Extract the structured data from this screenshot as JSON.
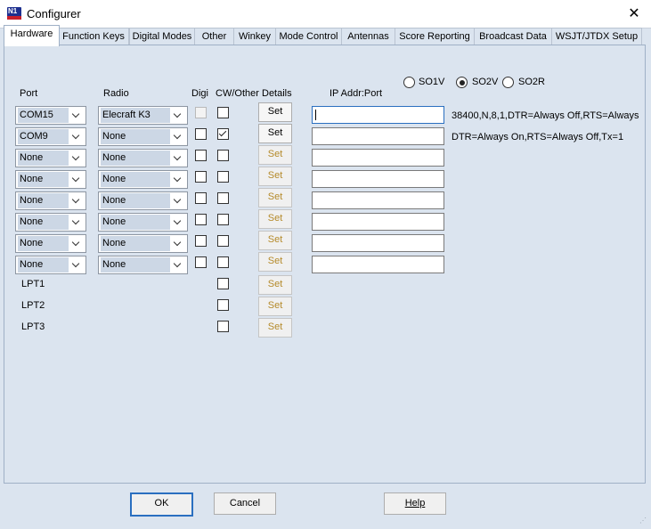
{
  "window": {
    "title": "Configurer",
    "close_glyph": "✕"
  },
  "tabs": [
    {
      "label": "Hardware",
      "active": true
    },
    {
      "label": "Function Keys"
    },
    {
      "label": "Digital Modes"
    },
    {
      "label": "Other"
    },
    {
      "label": "Winkey"
    },
    {
      "label": "Mode Control"
    },
    {
      "label": "Antennas"
    },
    {
      "label": "Score Reporting"
    },
    {
      "label": "Broadcast Data"
    },
    {
      "label": "WSJT/JTDX Setup"
    }
  ],
  "mode_radios": [
    {
      "label": "SO1V",
      "selected": false
    },
    {
      "label": "SO2V",
      "selected": true
    },
    {
      "label": "SO2R",
      "selected": false
    }
  ],
  "headers": {
    "port": "Port",
    "radio": "Radio",
    "digi": "Digi",
    "cw_other": "CW/Other",
    "details": "Details",
    "ip": "IP Addr:Port"
  },
  "rows": [
    {
      "port": "COM15",
      "radio": "Elecraft K3",
      "digi_disabled": true,
      "cw": false,
      "set": "Set",
      "set_active": true,
      "ip": "",
      "details": "38400,N,8,1,DTR=Always Off,RTS=Always"
    },
    {
      "port": "COM9",
      "radio": "None",
      "digi_disabled": false,
      "cw": true,
      "set": "Set",
      "set_active": true,
      "ip": "",
      "details": "DTR=Always On,RTS=Always Off,Tx=1"
    },
    {
      "port": "None",
      "radio": "None",
      "digi_disabled": false,
      "cw": false,
      "set": "Set",
      "set_active": false,
      "ip": "",
      "details": ""
    },
    {
      "port": "None",
      "radio": "None",
      "digi_disabled": false,
      "cw": false,
      "set": "Set",
      "set_active": false,
      "ip": "",
      "details": ""
    },
    {
      "port": "None",
      "radio": "None",
      "digi_disabled": false,
      "cw": false,
      "set": "Set",
      "set_active": false,
      "ip": "",
      "details": ""
    },
    {
      "port": "None",
      "radio": "None",
      "digi_disabled": false,
      "cw": false,
      "set": "Set",
      "set_active": false,
      "ip": "",
      "details": ""
    },
    {
      "port": "None",
      "radio": "None",
      "digi_disabled": false,
      "cw": false,
      "set": "Set",
      "set_active": false,
      "ip": "",
      "details": ""
    },
    {
      "port": "None",
      "radio": "None",
      "digi_disabled": false,
      "cw": false,
      "set": "Set",
      "set_active": false,
      "ip": "",
      "details": ""
    }
  ],
  "lpt_rows": [
    {
      "label": "LPT1",
      "cw": false,
      "set": "Set"
    },
    {
      "label": "LPT2",
      "cw": false,
      "set": "Set"
    },
    {
      "label": "LPT3",
      "cw": false,
      "set": "Set"
    }
  ],
  "buttons": {
    "ok": "OK",
    "cancel": "Cancel",
    "help": "Help"
  }
}
